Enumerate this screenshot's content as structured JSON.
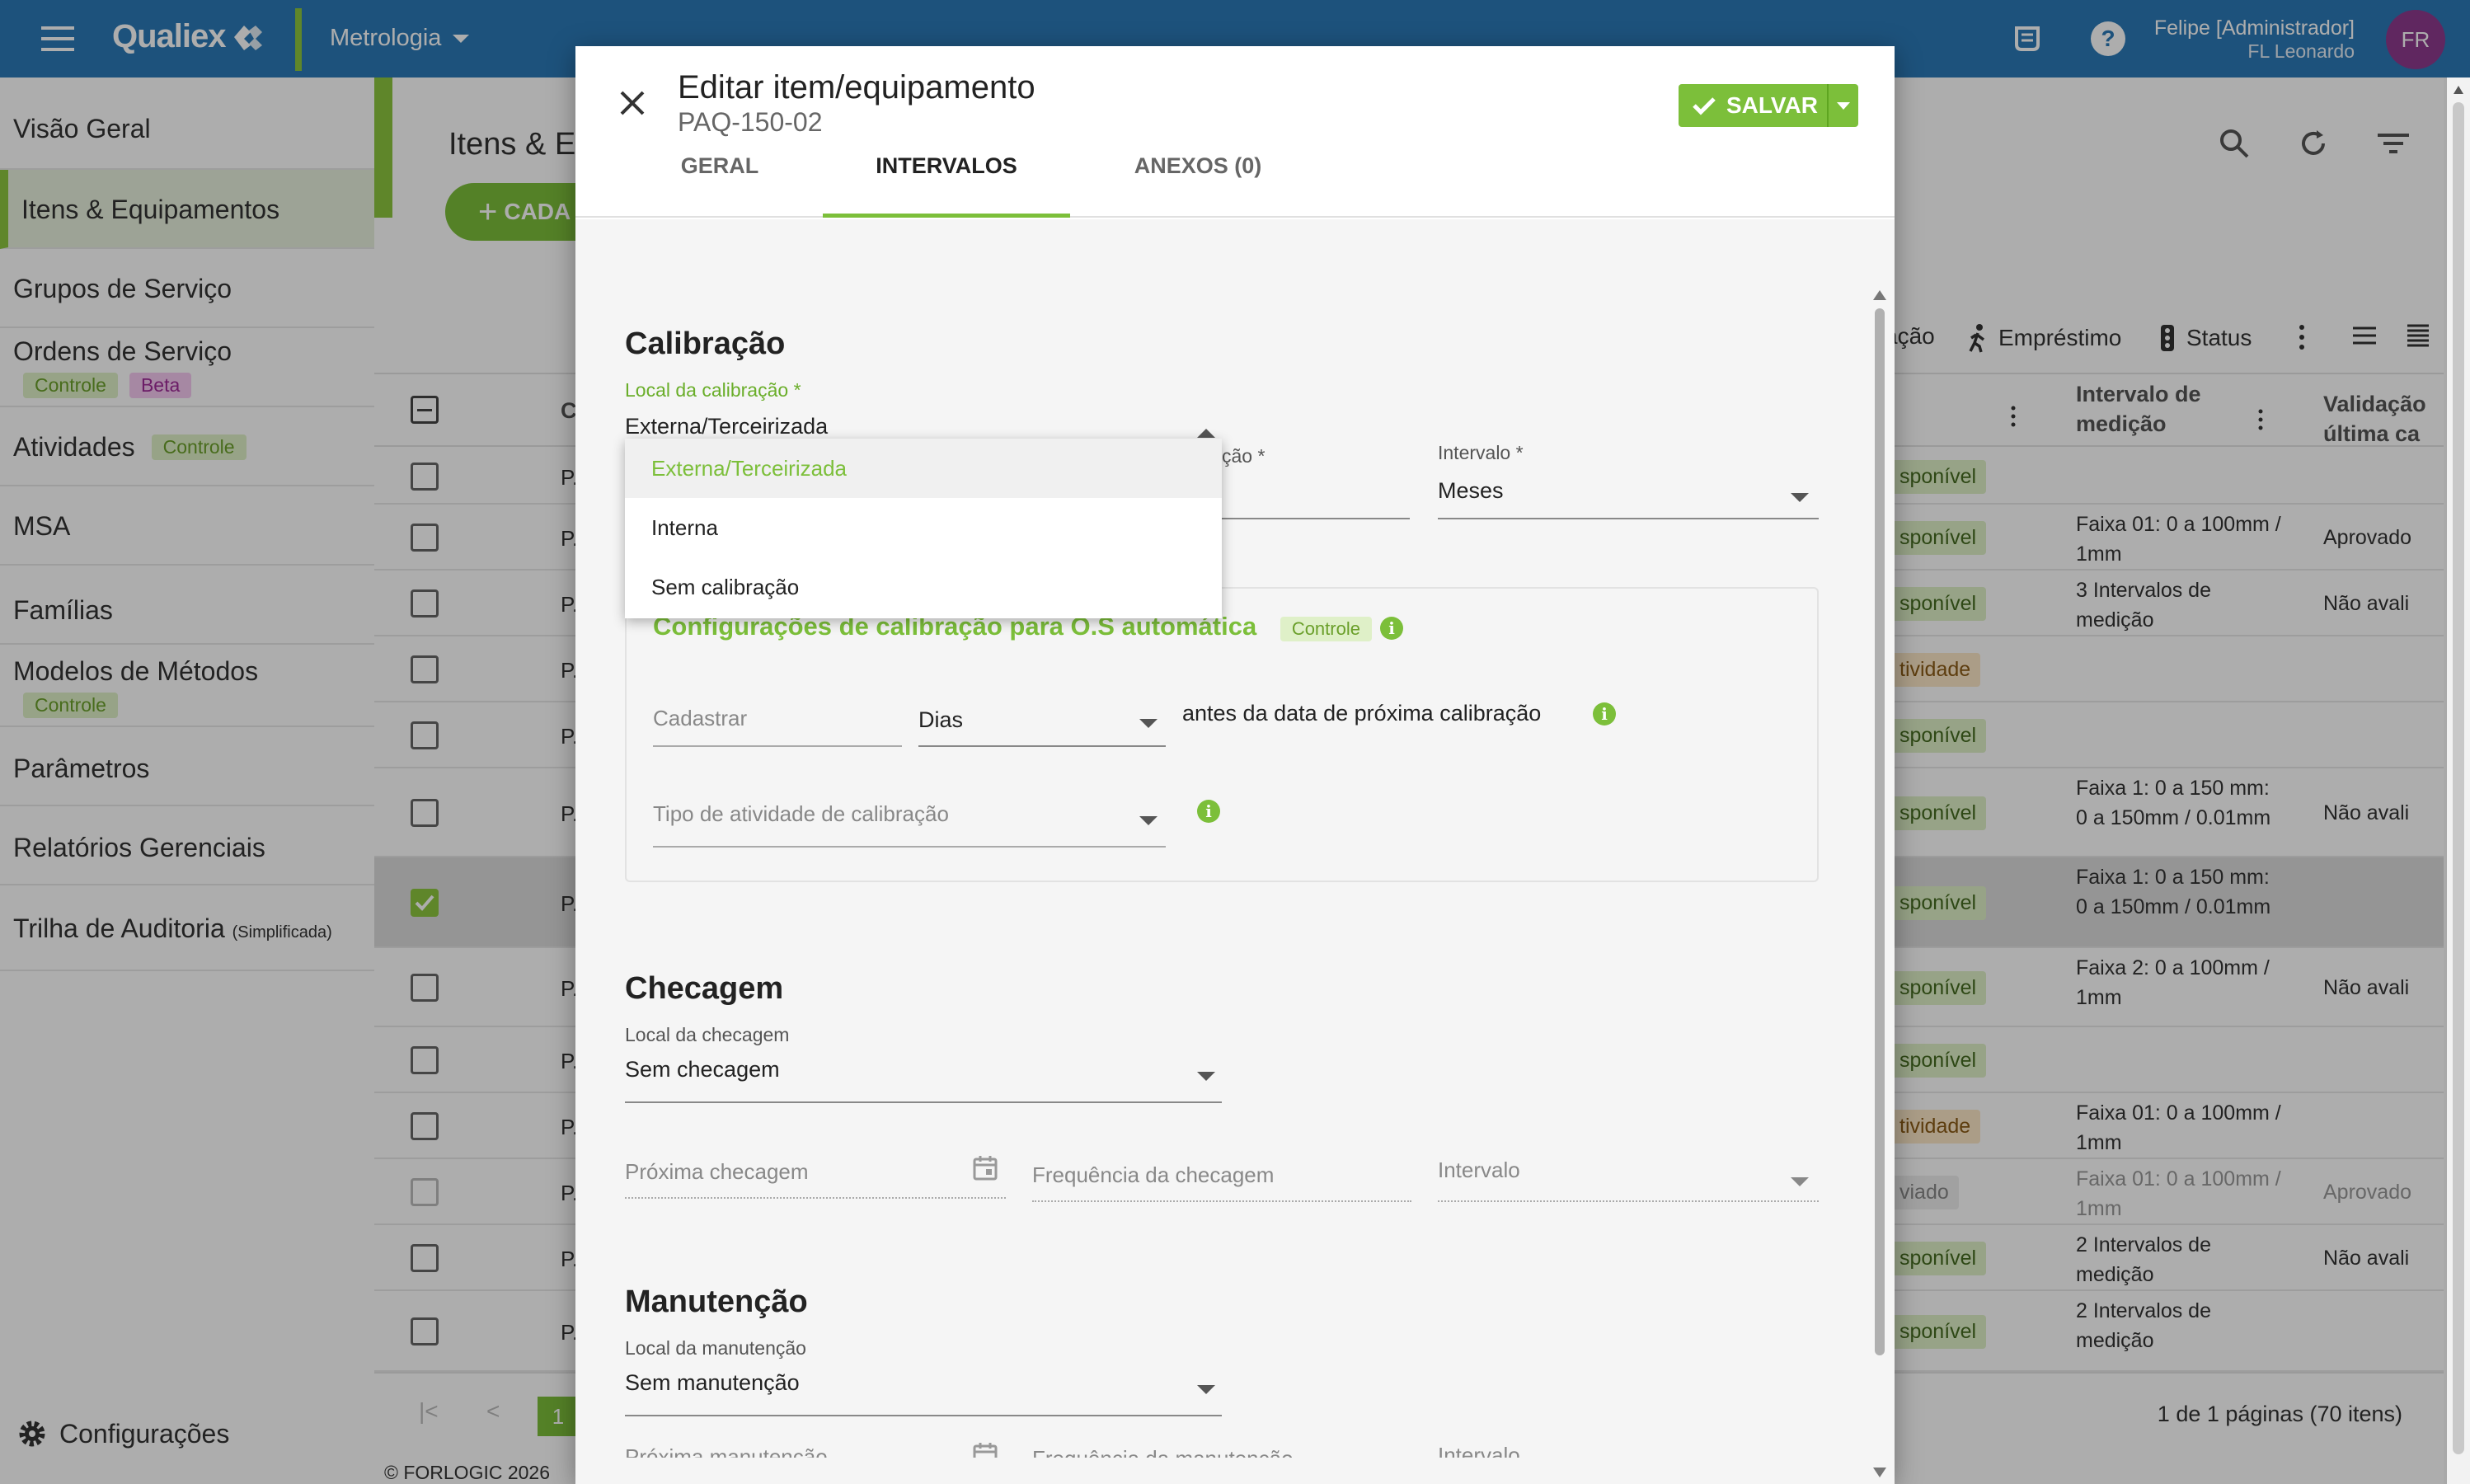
{
  "topbar": {
    "brand": "Qualiex",
    "module": "Metrologia",
    "user_name": "Felipe [Administrador]",
    "user_sub": "FL Leonardo",
    "avatar": "FR"
  },
  "sidebar": {
    "items": [
      {
        "label": "Visão Geral"
      },
      {
        "label": "Itens & Equipamentos"
      },
      {
        "label": "Grupos de Serviço"
      },
      {
        "label": "Ordens de Serviço",
        "badges": [
          "Controle",
          "Beta"
        ]
      },
      {
        "label": "Atividades",
        "badge": "Controle"
      },
      {
        "label": "MSA"
      },
      {
        "label": "Famílias"
      },
      {
        "label": "Modelos de Métodos",
        "badge": "Controle"
      },
      {
        "label": "Parâmetros"
      },
      {
        "label": "Relatórios Gerenciais"
      },
      {
        "label": "Trilha de Auditoria",
        "small": "(Simplificada)"
      }
    ],
    "config": "Configurações",
    "footer": "© FORLOGIC 2026"
  },
  "main": {
    "title": "Itens & Eq",
    "add": "CADA",
    "toolbar": {
      "acao": "ação",
      "emprestimo": "Empréstimo",
      "status": "Status"
    },
    "headers": {
      "code": "C",
      "intervalo": "Intervalo de medição",
      "validacao": "Validação última ca"
    },
    "rows": [
      {
        "status": "sponível",
        "interval": "",
        "valid": ""
      },
      {
        "status": "sponível",
        "interval": "Faixa 01: 0 a 100mm / 1mm",
        "valid": "Aprovado"
      },
      {
        "status": "sponível",
        "interval": "3 Intervalos de medição",
        "valid": "Não avali"
      },
      {
        "status": "tividade",
        "interval": "",
        "valid": ""
      },
      {
        "status": "sponível",
        "interval": "",
        "valid": ""
      },
      {
        "status": "sponível",
        "interval": "Faixa 1: 0 a 150 mm: 0 a 150mm / 0.01mm",
        "valid": "Não avali"
      },
      {
        "status": "sponível",
        "interval": "Faixa 1: 0 a 150 mm: 0 a 150mm / 0.01mm",
        "valid": ""
      },
      {
        "status": "sponível",
        "interval": "Faixa 2: 0 a 100mm / 1mm",
        "valid": "Não avali"
      },
      {
        "status": "sponível",
        "interval": "",
        "valid": ""
      },
      {
        "status": "tividade",
        "interval": "Faixa 01: 0 a 100mm / 1mm",
        "valid": ""
      },
      {
        "status": "viado",
        "interval": "Faixa 01: 0 a 100mm / 1mm",
        "valid": "Aprovado"
      },
      {
        "status": "sponível",
        "interval": "2 Intervalos de medição",
        "valid": "Não avali"
      },
      {
        "status": "sponível",
        "interval": "2 Intervalos de medição",
        "valid": ""
      }
    ],
    "page": "1",
    "page_info": "1 de 1 páginas (70 itens)"
  },
  "dialog": {
    "title": "Editar item/equipamento",
    "subtitle": "PAQ-150-02",
    "save": "SALVAR",
    "tabs": [
      "GERAL",
      "INTERVALOS",
      "ANEXOS (0)"
    ],
    "calibracao": {
      "title": "Calibração",
      "local_label": "Local da calibração *",
      "local_value": "Externa/Terceirizada",
      "options": [
        "Externa/Terceirizada",
        "Interna",
        "Sem calibração"
      ],
      "freq_label_partial": "ção *",
      "intervalo_label": "Intervalo *",
      "intervalo_value": "Meses",
      "auto_title": "Configurações de calibração para O.S automática",
      "auto_badge": "Controle",
      "cadastrar": "Cadastrar",
      "dias": "Dias",
      "antes": "antes da data de próxima calibração",
      "tipo": "Tipo de atividade de calibração"
    },
    "checagem": {
      "title": "Checagem",
      "local_label": "Local da checagem",
      "local_value": "Sem checagem",
      "proxima": "Próxima checagem",
      "frequencia": "Frequência da checagem",
      "intervalo": "Intervalo"
    },
    "manutencao": {
      "title": "Manutenção",
      "local_label": "Local da manutenção",
      "local_value": "Sem manutenção",
      "proxima": "Próxima manutenção",
      "frequencia": "Frequência da manutenção",
      "intervalo": "Intervalo"
    }
  },
  "colors": {
    "brand": "#2b7ab7",
    "accent": "#7cbf3a",
    "avatar": "#8e3a8e"
  }
}
